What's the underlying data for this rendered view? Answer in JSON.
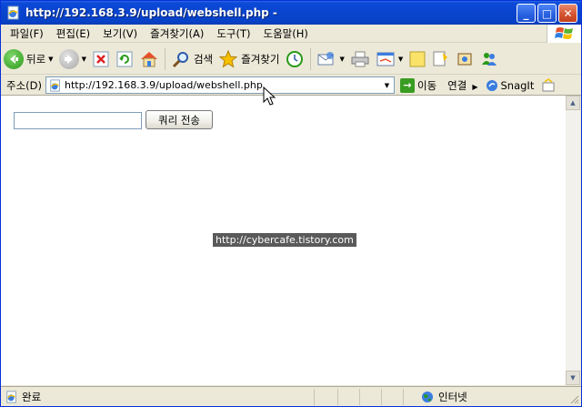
{
  "window": {
    "title": "http://192.168.3.9/upload/webshell.php -",
    "minimize_label": "_",
    "maximize_label": "□",
    "close_label": "✕"
  },
  "menu": {
    "items": [
      "파일(F)",
      "편집(E)",
      "보기(V)",
      "즐겨찾기(A)",
      "도구(T)",
      "도움말(H)"
    ]
  },
  "toolbar": {
    "back_label": "뒤로",
    "search_label": "검색",
    "favorites_label": "즐겨찾기"
  },
  "address": {
    "label": "주소(D)",
    "url": "http://192.168.3.9/upload/webshell.php",
    "go_label": "이동",
    "links_label": "연결",
    "snagit_label": "SnagIt"
  },
  "content": {
    "query_value": "",
    "submit_label": "쿼리 전송",
    "watermark": "http://cybercafe.tistory.com"
  },
  "status": {
    "text": "완료",
    "zone": "인터넷"
  },
  "colors": {
    "titlebar": "#0a45d0",
    "chrome": "#ece9d8",
    "go_green": "#3a9d23"
  }
}
